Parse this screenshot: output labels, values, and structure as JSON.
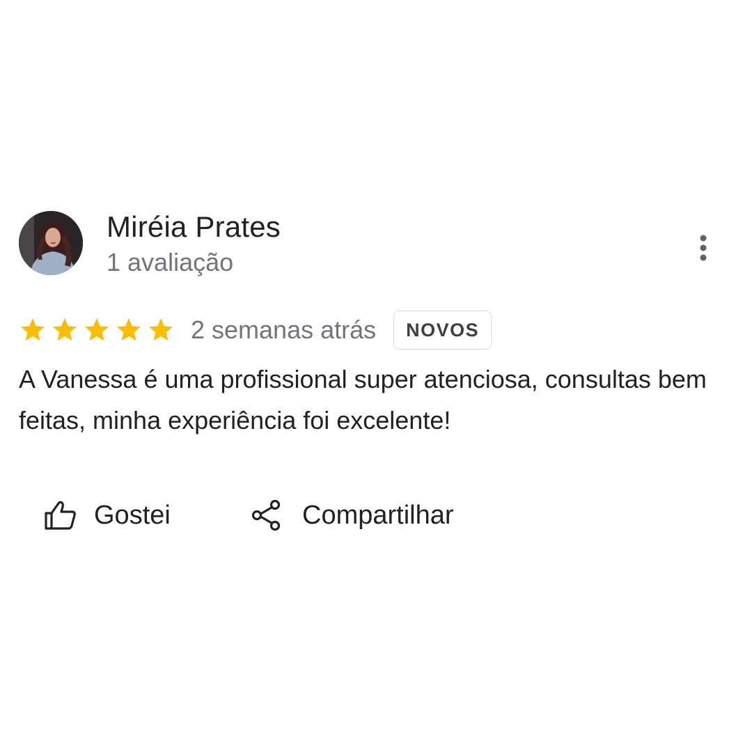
{
  "reviewer": {
    "name": "Miréia Prates",
    "review_count": "1 avaliação"
  },
  "review": {
    "rating": 5,
    "max_rating": 5,
    "date": "2 semanas atrás",
    "badge": "NOVOS",
    "text": "A Vanessa é uma profissional super atenciosa, consultas bem feitas, minha experiência foi excelente!"
  },
  "actions": {
    "like_label": "Gostei",
    "share_label": "Compartilhar"
  },
  "icons": {
    "avatar": "profile-photo",
    "more": "more-vert-icon",
    "star": "star-icon",
    "like": "thumb-up-icon",
    "share": "share-icon"
  },
  "colors": {
    "star": "#fbbc04",
    "primary_text": "#202124",
    "secondary_text": "#70757a",
    "badge_border": "#dadce0"
  }
}
